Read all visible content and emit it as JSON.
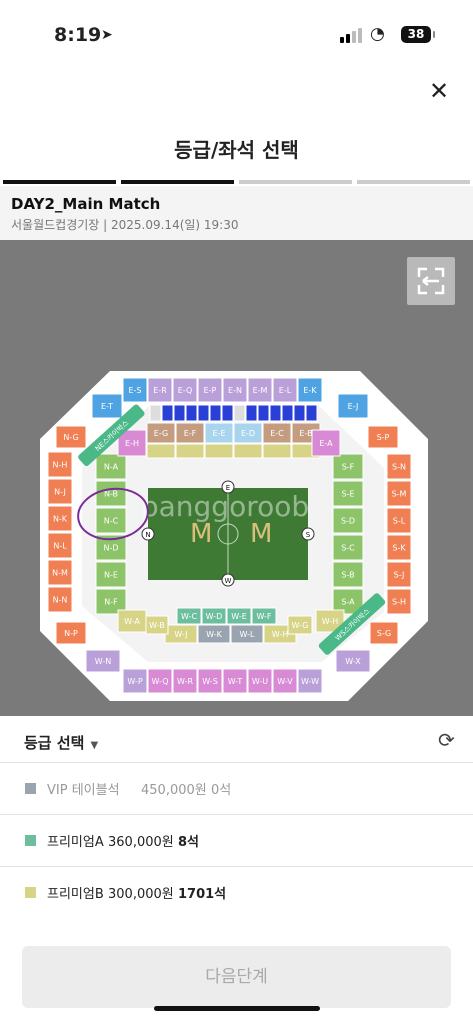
{
  "status_bar": {
    "time": "8:19",
    "battery": "38"
  },
  "header": {
    "title": "등급/좌석 선택"
  },
  "event": {
    "name": "DAY2_Main Match",
    "info": "서울월드컵경기장 | 2025.09.14(일) 19:30"
  },
  "map": {
    "watermark": "panggoroob",
    "field_labels": {
      "north": "N",
      "south": "S",
      "east": "E",
      "west": "W"
    },
    "ribbons": {
      "ne": "NE스카이박스",
      "ws": "WS스카이박스"
    },
    "colors": {
      "green": "#8dc469",
      "teal": "#6dbe9f",
      "orange": "#f07f54",
      "lavender": "#b9a0d8",
      "blue": "#4fa3e3",
      "khaki": "#d7d488",
      "pink": "#d88ad4",
      "brown": "#c49c80",
      "lightblue": "#a9d4ee"
    },
    "stands": {
      "north_upper": [
        "N-H",
        "N-J",
        "N-K",
        "N-L",
        "N-M",
        "N-N"
      ],
      "north_lower": [
        "N-A",
        "N-B",
        "N-C",
        "N-D",
        "N-E",
        "N-F"
      ],
      "south_upper": [
        "S-N",
        "S-M",
        "S-L",
        "S-K",
        "S-J",
        "S-H"
      ],
      "south_lower": [
        "S-F",
        "S-E",
        "S-D",
        "S-C",
        "S-B",
        "S-A"
      ],
      "east_upper": [
        "E-S",
        "E-R",
        "E-Q",
        "E-P",
        "E-N",
        "E-M",
        "E-L",
        "E-K"
      ],
      "east_lower": [
        "E-G",
        "E-F",
        "E-E",
        "E-D",
        "E-C",
        "E-B"
      ],
      "west_upper": [
        "W-P",
        "W-Q",
        "W-R",
        "W-S",
        "W-T",
        "W-U",
        "W-V",
        "W-W"
      ],
      "west_lower": [
        "W-C",
        "W-D",
        "W-E",
        "W-F"
      ],
      "west_lower2": [
        "W-J",
        "W-K",
        "W-L",
        "W-H"
      ],
      "corners": [
        "N-G",
        "E-T",
        "E-J",
        "S-P",
        "N-P",
        "W-N",
        "W-X",
        "S-G",
        "E-H",
        "E-A",
        "W-A",
        "W-B",
        "W-G",
        "W-H"
      ]
    }
  },
  "grade": {
    "heading": "등급 선택",
    "items": [
      {
        "name": "VIP 테이블석",
        "price": "450,000원",
        "count": "0석",
        "color": "#9aa4b0",
        "muted": true
      },
      {
        "name": "프리미엄A",
        "price": "360,000원",
        "count": "8석",
        "color": "#6dbe9f",
        "muted": false
      },
      {
        "name": "프리미엄B",
        "price": "300,000원",
        "count": "1701석",
        "color": "#d7d488",
        "muted": false
      }
    ]
  },
  "footer": {
    "next_label": "다음단계"
  }
}
